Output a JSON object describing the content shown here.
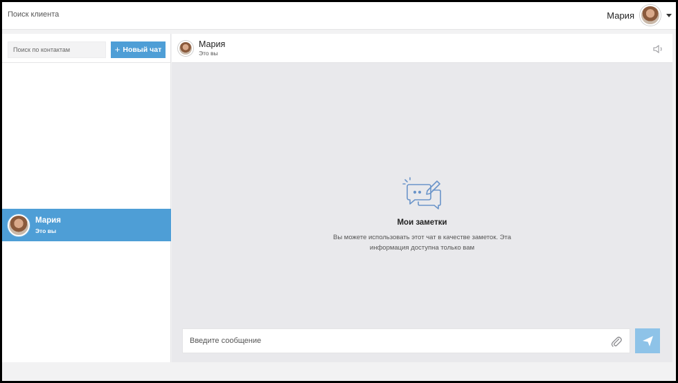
{
  "topbar": {
    "search_label": "Поиск клиента",
    "user_name": "Мария"
  },
  "sidebar": {
    "search_placeholder": "Поиск по контактам",
    "new_chat_label": "Новый чат",
    "contacts": [
      {
        "name": "Мария",
        "subtitle": "Это вы",
        "selected": true
      }
    ]
  },
  "chat": {
    "header": {
      "name": "Мария",
      "subtitle": "Это вы"
    },
    "empty_state": {
      "title": "Мои заметки",
      "description": "Вы можете использовать этот чат в качестве заметок. Эта информация доступна только вам"
    },
    "composer": {
      "placeholder": "Введите сообщение"
    }
  },
  "colors": {
    "accent": "#4e9ed6",
    "send_button": "#8ec3e8",
    "chat_background": "#e9e9ec",
    "icon": "#6a94c9"
  },
  "icons": {
    "topbar_user": "avatar",
    "menu": "caret-down-icon",
    "mute": "speaker-icon",
    "empty_state": "notes-chat-icon",
    "attach": "paperclip-icon",
    "send": "paper-plane-icon"
  }
}
